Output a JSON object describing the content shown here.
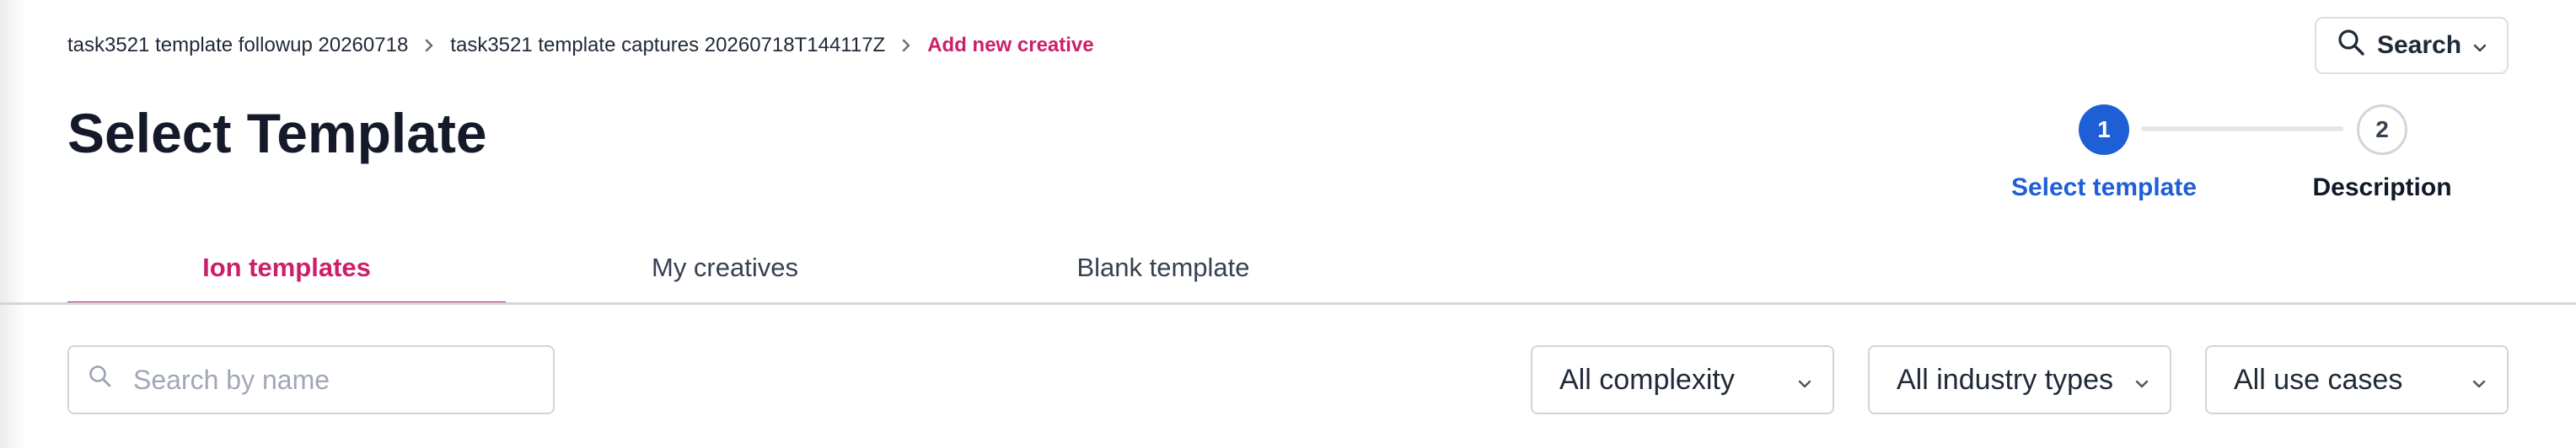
{
  "breadcrumb": {
    "items": [
      "task3521 template followup 20260718",
      "task3521 template captures 20260718T144117Z"
    ],
    "current": "Add new creative"
  },
  "header": {
    "title": "Select Template",
    "search_button_label": "Search"
  },
  "stepper": {
    "steps": [
      {
        "number": "1",
        "label": "Select template",
        "state": "active"
      },
      {
        "number": "2",
        "label": "Description",
        "state": "inactive"
      }
    ]
  },
  "tabs": [
    {
      "label": "Ion templates",
      "active": true
    },
    {
      "label": "My creatives",
      "active": false
    },
    {
      "label": "Blank template",
      "active": false
    }
  ],
  "filters": {
    "search": {
      "placeholder": "Search by name",
      "value": ""
    },
    "complexity": "All complexity",
    "industry": "All industry types",
    "use_cases": "All use cases"
  },
  "colors": {
    "accent": "#cc1f6a",
    "primary": "#1f5fd6",
    "border": "#cfd5de"
  },
  "icons": {
    "breadcrumb_separator": "chevron-right-icon",
    "search": "search-icon",
    "dropdown": "chevron-down-icon"
  }
}
